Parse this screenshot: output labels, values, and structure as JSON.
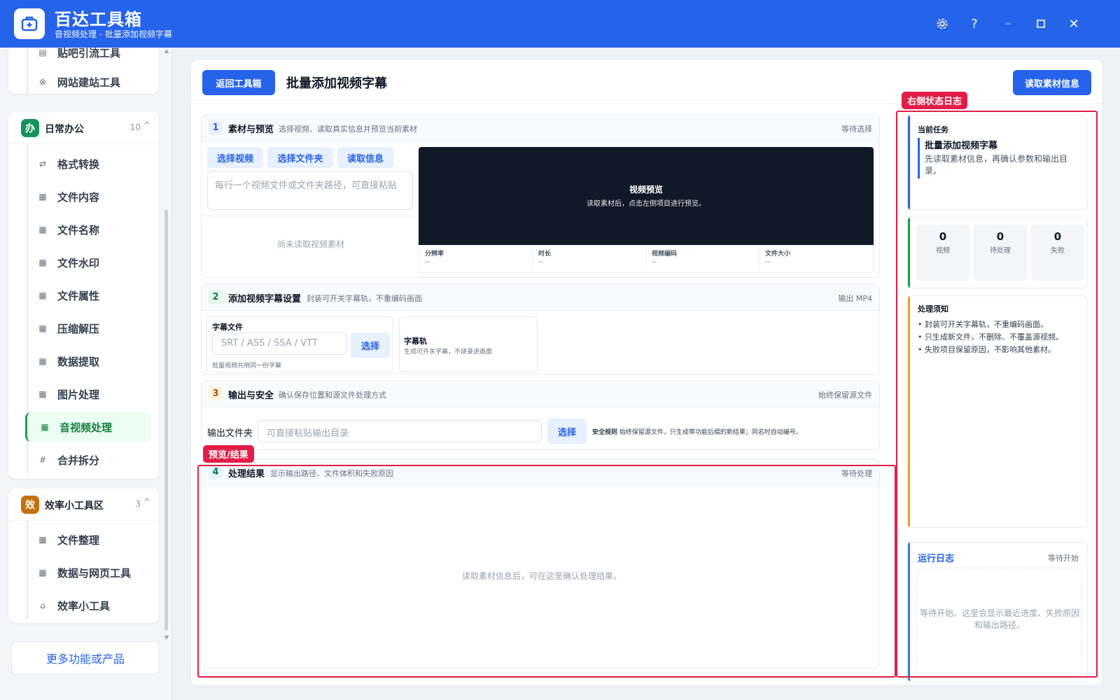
{
  "app": {
    "name": "百达工具箱",
    "subtitle": "音视频处理 - 批量添加视频字幕",
    "window_controls": [
      "gear-icon",
      "help-icon",
      "minimize-icon",
      "maximize-icon",
      "close-icon"
    ]
  },
  "sidebar": {
    "top_items": [
      {
        "icon": "list-icon",
        "label": "贴吧引流工具"
      },
      {
        "icon": "globe-icon",
        "label": "网站建站工具"
      }
    ],
    "group_office": {
      "badge": "办",
      "title": "日常办公",
      "count": "10",
      "caret": "^",
      "items": [
        {
          "icon": "swap-icon",
          "label": "格式转换"
        },
        {
          "icon": "grid-icon",
          "label": "文件内容"
        },
        {
          "icon": "grid-icon",
          "label": "文件名称"
        },
        {
          "icon": "grid-icon",
          "label": "文件水印"
        },
        {
          "icon": "grid-icon",
          "label": "文件属性"
        },
        {
          "icon": "grid-icon",
          "label": "压缩解压"
        },
        {
          "icon": "grid-icon",
          "label": "数据提取"
        },
        {
          "icon": "grid-icon",
          "label": "图片处理"
        },
        {
          "icon": "grid-icon",
          "label": "音视频处理",
          "active": true
        },
        {
          "icon": "hash-icon",
          "label": "合并拆分"
        }
      ]
    },
    "group_efficiency": {
      "badge": "效",
      "title": "效率小工具区",
      "count": "3",
      "caret": "^",
      "items": [
        {
          "icon": "grid-icon",
          "label": "文件整理"
        },
        {
          "icon": "grid-icon",
          "label": "数据与网页工具"
        },
        {
          "icon": "toolbox-icon",
          "label": "效率小工具"
        }
      ]
    },
    "more_button": "更多功能或产品"
  },
  "header": {
    "back_button": "返回工具箱",
    "title": "批量添加视频字幕",
    "read_button": "读取素材信息"
  },
  "section1": {
    "num": "1",
    "title": "素材与预览",
    "desc": "选择视频、读取真实信息并预览当前素材",
    "status": "等待选择",
    "buttons": [
      "选择视频",
      "选择文件夹",
      "读取信息"
    ],
    "textarea_placeholder": "每行一个视频文件或文件夹路径，可直接粘贴",
    "empty_text": "尚未读取视频素材",
    "preview_title": "视频预览",
    "preview_hint": "读取素材后，点击左侧项目进行预览。",
    "meta": [
      {
        "k": "分辨率",
        "v": "--"
      },
      {
        "k": "时长",
        "v": "--"
      },
      {
        "k": "视频编码",
        "v": "--"
      },
      {
        "k": "文件大小",
        "v": "--"
      }
    ]
  },
  "section2": {
    "num": "2",
    "title": "添加视频字幕设置",
    "desc": "封装可开关字幕轨，不重编码画面",
    "status": "输出 MP4",
    "subtitle_label": "字幕文件",
    "subtitle_placeholder": "SRT / ASS / SSA / VTT",
    "choose": "选择",
    "subtitle_note": "批量视频共用同一份字幕",
    "track_title": "字幕轨",
    "track_desc": "生成可开关字幕，不烧录进画面"
  },
  "section3": {
    "num": "3",
    "title": "输出与安全",
    "desc": "确认保存位置和源文件处理方式",
    "status": "始终保留源文件",
    "output_label": "输出文件夹",
    "output_placeholder": "可直接粘贴输出目录",
    "choose": "选择",
    "rule_label": "安全规则",
    "rule_text": "始终保留源文件，只生成带功能后缀的新结果；同名时自动编号。"
  },
  "section4": {
    "num": "4",
    "title": "处理结果",
    "desc": "显示输出路径、文件体积和失败原因",
    "status": "等待处理",
    "empty_text": "读取素材信息后，可在这里确认处理结果。"
  },
  "right": {
    "task_label": "当前任务",
    "task_title": "批量添加视频字幕",
    "task_desc": "先读取素材信息，再确认参数和输出目录。",
    "stats": [
      {
        "num": "0",
        "label": "视频"
      },
      {
        "num": "0",
        "label": "待处理"
      },
      {
        "num": "0",
        "label": "失败"
      }
    ],
    "notes_title": "处理须知",
    "notes": [
      "封装可开关字幕轨，不重编码画面。",
      "只生成新文件，不删除、不覆盖源视频。",
      "失败项目保留原因，不影响其他素材。"
    ],
    "log_title": "运行日志",
    "log_status": "等待开始",
    "log_empty": "等待开始。这里会显示最近进度、失败原因和输出路径。"
  },
  "annotations": {
    "right_log": "右侧状态日志",
    "preview_result": "预览/结果"
  },
  "colors": {
    "primary": "#2563eb",
    "active_green": "#16a34a",
    "annotation_red": "#e11d48",
    "badge_office": "#15935b",
    "badge_efficiency": "#c2710c"
  }
}
